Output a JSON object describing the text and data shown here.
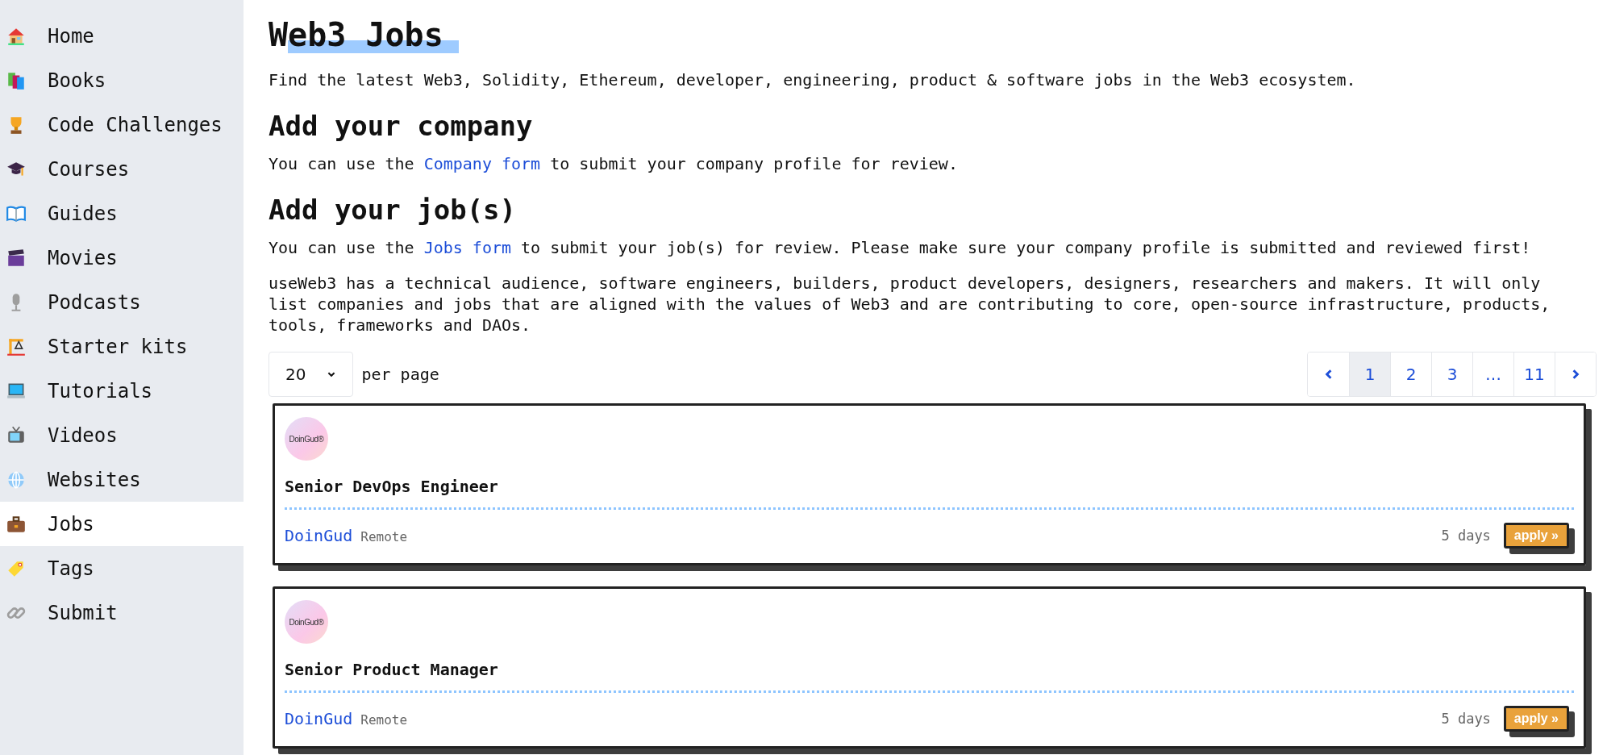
{
  "sidebar": {
    "items": [
      {
        "label": "Home",
        "selected": false
      },
      {
        "label": "Books",
        "selected": false
      },
      {
        "label": "Code Challenges",
        "selected": false
      },
      {
        "label": "Courses",
        "selected": false
      },
      {
        "label": "Guides",
        "selected": false
      },
      {
        "label": "Movies",
        "selected": false
      },
      {
        "label": "Podcasts",
        "selected": false
      },
      {
        "label": "Starter kits",
        "selected": false
      },
      {
        "label": "Tutorials",
        "selected": false
      },
      {
        "label": "Videos",
        "selected": false
      },
      {
        "label": "Websites",
        "selected": false
      },
      {
        "label": "Jobs",
        "selected": true
      },
      {
        "label": "Tags",
        "selected": false
      },
      {
        "label": "Submit",
        "selected": false
      }
    ]
  },
  "title": "Web3 Jobs",
  "intro": "Find the latest Web3, Solidity, Ethereum, developer, engineering, product & software jobs in the Web3 ecosystem.",
  "sections": [
    {
      "heading": "Add your company",
      "before": "You can use the ",
      "link": "Company form",
      "after": " to submit your company profile for review."
    },
    {
      "heading": "Add your job(s)",
      "before": "You can use the ",
      "link": "Jobs form",
      "after": " to submit your job(s) for review. Please make sure your company profile is submitted and reviewed first!"
    }
  ],
  "about": "useWeb3 has a technical audience, software engineers, builders, product developers, designers, researchers and makers. It will only list companies and jobs that are aligned with the values of Web3 and are contributing to core, open-source infrastructure, products, tools, frameworks and DAOs.",
  "per_page": {
    "value": "20",
    "label": "per page"
  },
  "pagination": {
    "pages": [
      {
        "label": "1",
        "selected": true
      },
      {
        "label": "2",
        "selected": false
      },
      {
        "label": "3",
        "selected": false
      },
      {
        "label": "…",
        "selected": false
      },
      {
        "label": "11",
        "selected": false
      }
    ]
  },
  "jobs": [
    {
      "logo_text": "DoinGud®",
      "title": "Senior DevOps Engineer",
      "company": "DoinGud",
      "location": "Remote",
      "age": "5 days",
      "action": "apply »"
    },
    {
      "logo_text": "DoinGud®",
      "title": "Senior Product Manager",
      "company": "DoinGud",
      "location": "Remote",
      "age": "5 days",
      "action": "apply »"
    }
  ]
}
